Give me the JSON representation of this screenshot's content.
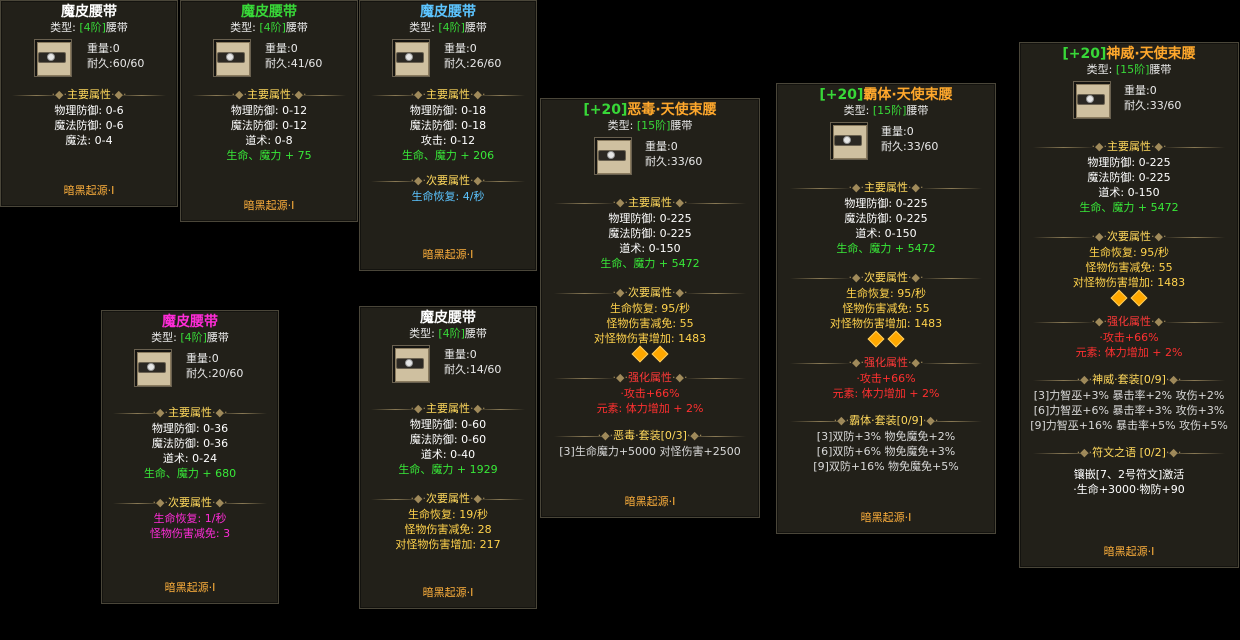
{
  "common": {
    "origin": "暗黑起源·I",
    "type_prefix": "类型:",
    "type_suffix": "腰带",
    "weight_label": "重量:",
    "durability_label": "耐久:",
    "main_attr_label": "主要属性",
    "sub_attr_label": "次要属性",
    "strengthen_label": "强化属性",
    "ornament_left": "·◆·",
    "ornament_right": "·◆·"
  },
  "cards": {
    "c1": {
      "title": "魔皮腰带",
      "tier": "[4阶]",
      "weight": "0",
      "durability": "60/60",
      "main": [
        "物理防御: 0-6",
        "魔法防御: 0-6",
        "魔法: 0-4"
      ]
    },
    "c2": {
      "title": "魔皮腰带",
      "tier": "[4阶]",
      "weight": "0",
      "durability": "41/60",
      "main": [
        "物理防御: 0-12",
        "魔法防御: 0-12",
        "道术: 0-8"
      ],
      "main_bonus": "生命、魔力 + 75"
    },
    "c3": {
      "title": "魔皮腰带",
      "tier": "[4阶]",
      "weight": "0",
      "durability": "26/60",
      "main": [
        "物理防御: 0-18",
        "魔法防御: 0-18",
        "攻击: 0-12"
      ],
      "main_bonus": "生命、魔力 + 206",
      "sub": [
        "生命恢复: 4/秒"
      ]
    },
    "c4": {
      "title": "魔皮腰带",
      "tier": "[4阶]",
      "weight": "0",
      "durability": "20/60",
      "main": [
        "物理防御: 0-36",
        "魔法防御: 0-36",
        "道术: 0-24"
      ],
      "main_bonus": "生命、魔力 + 680",
      "sub": [
        "生命恢复: 1/秒",
        "怪物伤害减免: 3"
      ]
    },
    "c5": {
      "title": "魔皮腰带",
      "tier": "[4阶]",
      "weight": "0",
      "durability": "14/60",
      "main": [
        "物理防御: 0-60",
        "魔法防御: 0-60",
        "道术: 0-40"
      ],
      "main_bonus": "生命、魔力 + 1929",
      "sub": [
        "生命恢复: 19/秒",
        "怪物伤害减免: 28",
        "对怪物伤害增加: 217"
      ]
    },
    "c6": {
      "title_bracket": "[+20]",
      "title": "恶毒·天使束腰",
      "tier": "[15阶]",
      "weight": "0",
      "durability": "33/60",
      "main": [
        "物理防御: 0-225",
        "魔法防御: 0-225",
        "道术: 0-150"
      ],
      "main_bonus": "生命、魔力 + 5472",
      "sub": [
        "生命恢复: 95/秒",
        "怪物伤害减免: 55",
        "对怪物伤害增加: 1483"
      ],
      "strengthen": [
        "·攻击+66%",
        "元素: 体力增加 + 2%"
      ],
      "set_label": "恶毒·套装[0/3]",
      "set_lines": [
        "[3]生命魔力+5000 对怪伤害+2500"
      ]
    },
    "c7": {
      "title_bracket": "[+20]",
      "title": "霸体·天使束腰",
      "tier": "[15阶]",
      "weight": "0",
      "durability": "33/60",
      "main": [
        "物理防御: 0-225",
        "魔法防御: 0-225",
        "道术: 0-150"
      ],
      "main_bonus": "生命、魔力 + 5472",
      "sub": [
        "生命恢复: 95/秒",
        "怪物伤害减免: 55",
        "对怪物伤害增加: 1483"
      ],
      "strengthen": [
        "·攻击+66%",
        "元素: 体力增加 + 2%"
      ],
      "set_label": "霸体·套装[0/9]",
      "set_lines": [
        "[3]双防+3% 物免魔免+2%",
        "[6]双防+6% 物免魔免+3%",
        "[9]双防+16% 物免魔免+5%"
      ]
    },
    "c8": {
      "title_bracket": "[+20]",
      "title": "神威·天使束腰",
      "tier": "[15阶]",
      "weight": "0",
      "durability": "33/60",
      "main": [
        "物理防御: 0-225",
        "魔法防御: 0-225",
        "道术: 0-150"
      ],
      "main_bonus": "生命、魔力 + 5472",
      "sub": [
        "生命恢复: 95/秒",
        "怪物伤害减免: 55",
        "对怪物伤害增加: 1483"
      ],
      "strengthen": [
        "·攻击+66%",
        "元素: 体力增加 + 2%"
      ],
      "set_label": "神威·套装[0/9]",
      "set_lines": [
        "[3]力智巫+3% 暴击率+2% 攻伤+2%",
        "[6]力智巫+6% 暴击率+3% 攻伤+3%",
        "[9]力智巫+16% 暴击率+5% 攻伤+5%"
      ],
      "rune_label": "符文之语 [0/2]",
      "rune_lines": [
        "镶嵌[7、2号符文]激活",
        "·生命+3000·物防+90"
      ]
    }
  }
}
